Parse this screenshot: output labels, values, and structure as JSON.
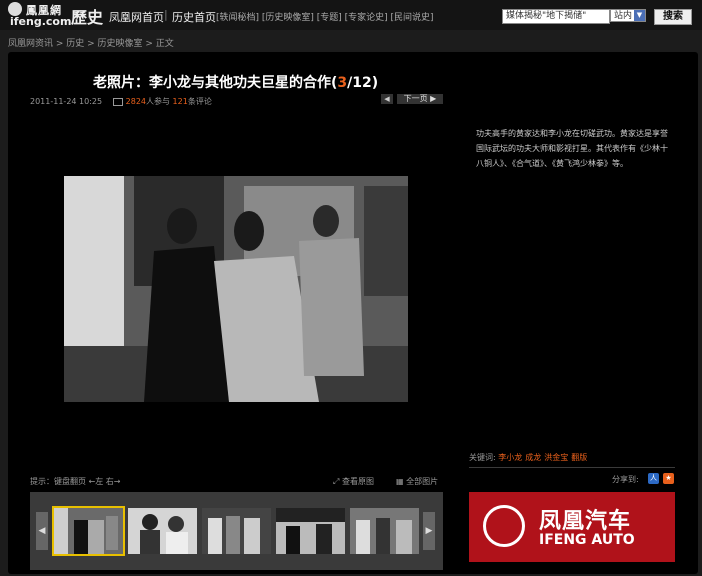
{
  "header": {
    "logo_cn": "鳳凰網",
    "logo_en": "ifeng.com",
    "channel": "歷史",
    "nav": [
      "凤凰网首页",
      "历史首页"
    ],
    "subnav": "[轶闻秘档] [历史映像室] [专题] [专家论史] [民间说史]",
    "search_value": "媒体揭秘\"地下揭储\"",
    "site_select": "站内",
    "search_button": "搜索"
  },
  "breadcrumb": "凤凰网资讯  >  历史  >  历史映像室  >  正文",
  "article": {
    "title": "老照片：李小龙与其他功夫巨星的合作",
    "page_current": "3",
    "page_total": "/12",
    "datetime": "2011-11-24 10:25",
    "participants": "2824",
    "participants_suffix": "人参与",
    "comments": "121",
    "comments_suffix": "条评论",
    "next_label": "下一页"
  },
  "caption": "功夫高手的黄家达和李小龙在切磋武功。黄家达是享誉国际武坛的功夫大师和影视打星。其代表作有《少林十八铜人》、《合气道》、《黄飞鸿少林拳》等。",
  "keywords": {
    "label": "关键词:",
    "items": [
      "李小龙",
      "成龙",
      "洪金宝",
      "翻版"
    ]
  },
  "share_label": "分享到:",
  "ad": {
    "cn": "凤凰汽车",
    "en": "IFENG AUTO"
  },
  "controls": {
    "hint": "提示：键盘翻页 ←左 右→",
    "view_original": "查看原图",
    "all_pictures": "全部图片"
  },
  "thumbnails": [
    {
      "selected": true
    },
    {
      "selected": false
    },
    {
      "selected": false
    },
    {
      "selected": false
    },
    {
      "selected": false
    }
  ],
  "colors": {
    "accent": "#e8601c",
    "ad": "#b0121a",
    "highlight": "#e8c000"
  }
}
